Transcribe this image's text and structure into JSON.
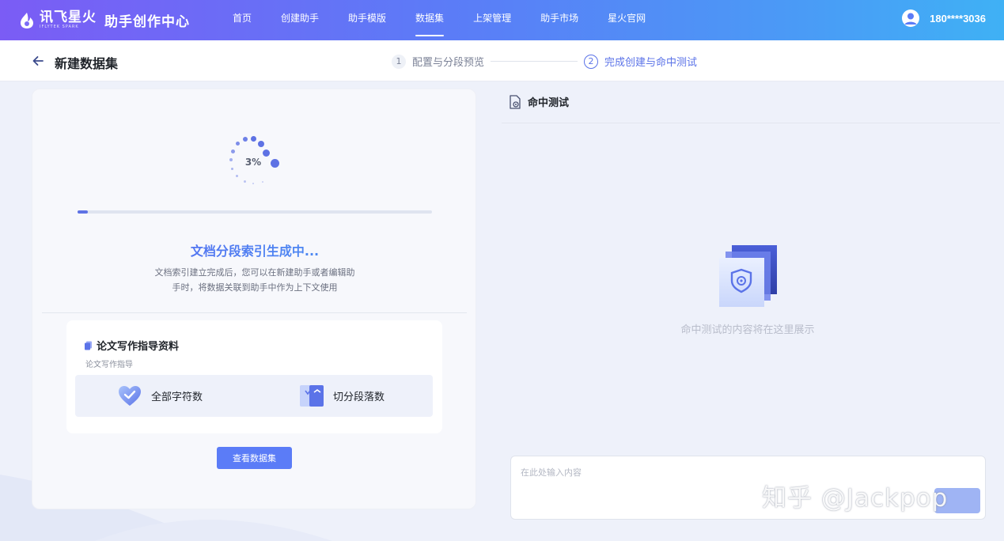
{
  "brand": {
    "name": "讯飞星火",
    "subtitle": "IFLYTEK SPARK",
    "title": "助手创作中心"
  },
  "nav": {
    "items": [
      {
        "label": "首页"
      },
      {
        "label": "创建助手"
      },
      {
        "label": "助手模版"
      },
      {
        "label": "数据集",
        "active": true
      },
      {
        "label": "上架管理"
      },
      {
        "label": "助手市场"
      },
      {
        "label": "星火官网"
      }
    ]
  },
  "user": {
    "name": "180****3036",
    "icon": "user-avatar-icon"
  },
  "header": {
    "title": "新建数据集",
    "back_icon": "arrow-left-icon"
  },
  "steps": [
    {
      "number": "1",
      "label": "配置与分段预览",
      "status": "done"
    },
    {
      "number": "2",
      "label": "完成创建与命中测试",
      "status": "current"
    }
  ],
  "progress": {
    "percent_text": "3%",
    "value": 0.03
  },
  "generation": {
    "title": "文档分段索引生成中...",
    "desc_line1": "文档索引建立完成后，您可以在新建助手或者编辑助",
    "desc_line2": "手时，将数据关联到助手中作为上下文使用"
  },
  "dataset": {
    "title": "论文写作指导资料",
    "subtitle": "论文写作指导",
    "stats": [
      {
        "label": "全部字符数",
        "icon": "heart-badge-icon"
      },
      {
        "label": "切分段落数",
        "icon": "split-cards-icon"
      }
    ],
    "view_button": "查看数据集"
  },
  "hit_test": {
    "title": "命中测试",
    "empty_text": "命中测试的内容将在这里展示",
    "input_placeholder": "在此处输入内容"
  },
  "watermark": "知乎 @Jackpop",
  "colors": {
    "accent": "#5b7cf7",
    "nav_gradient_start": "#7b5cf5",
    "nav_gradient_end": "#3fb1f5"
  }
}
